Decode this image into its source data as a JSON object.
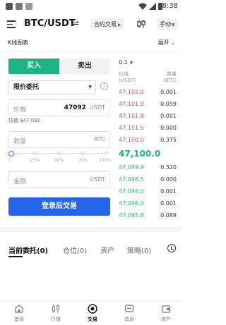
{
  "status": {
    "time": "8:38"
  },
  "header": {
    "pair": "BTC/USDT",
    "swap_icon": "⇌",
    "contract_label": "合约交易",
    "mode_label": "手动"
  },
  "kline": {
    "label": "K线图表",
    "expand_label": "展开"
  },
  "trade": {
    "buy_label": "买入",
    "sell_label": "卖出",
    "order_type": "限价委托",
    "info_icon": "i",
    "price_placeholder": "价格",
    "price_value": "47092",
    "price_unit": "USDT",
    "estimate": "估值 $47,092",
    "qty_placeholder": "数量",
    "qty_unit": "BTC",
    "slider_ticks": [
      "0",
      "25%",
      "50%",
      "75%",
      "100%"
    ],
    "slider_value_percent": 0,
    "amount_placeholder": "金额",
    "amount_unit": "USDT",
    "login_button": "登录后交易"
  },
  "orderbook": {
    "depth": "0.1",
    "price_header": [
      "价格",
      "(USDT)"
    ],
    "amount_header": [
      "数量",
      "(BTC)"
    ],
    "asks": [
      {
        "price": "47,102.0",
        "amount": "0.001"
      },
      {
        "price": "47,101.9",
        "amount": "0.059"
      },
      {
        "price": "47,101.8",
        "amount": "0.001"
      },
      {
        "price": "47,101.5",
        "amount": "0.000"
      },
      {
        "price": "47,100.0",
        "amount": "0.375"
      }
    ],
    "last_price": "47,100.0",
    "bids": [
      {
        "price": "47,099.9",
        "amount": "0.320"
      },
      {
        "price": "47,098.5",
        "amount": "0.000"
      },
      {
        "price": "47,098.0",
        "amount": "0.001"
      },
      {
        "price": "47,096.0",
        "amount": "0.001"
      },
      {
        "price": "47,095.8",
        "amount": "0.089"
      }
    ]
  },
  "orders_tabs": [
    {
      "label": "当前委托(0)"
    },
    {
      "label": "仓位(0)"
    },
    {
      "label": "资产"
    },
    {
      "label": "策略(0)"
    }
  ],
  "nav": [
    {
      "label": "首页",
      "icon": "home-icon"
    },
    {
      "label": "行情",
      "icon": "market-icon"
    },
    {
      "label": "交易",
      "icon": "trade-icon"
    },
    {
      "label": "消息",
      "icon": "message-icon"
    },
    {
      "label": "资产",
      "icon": "wallet-icon"
    }
  ],
  "colors": {
    "buy": "#1db386",
    "sell": "#e04a59",
    "primary": "#2364e8"
  }
}
